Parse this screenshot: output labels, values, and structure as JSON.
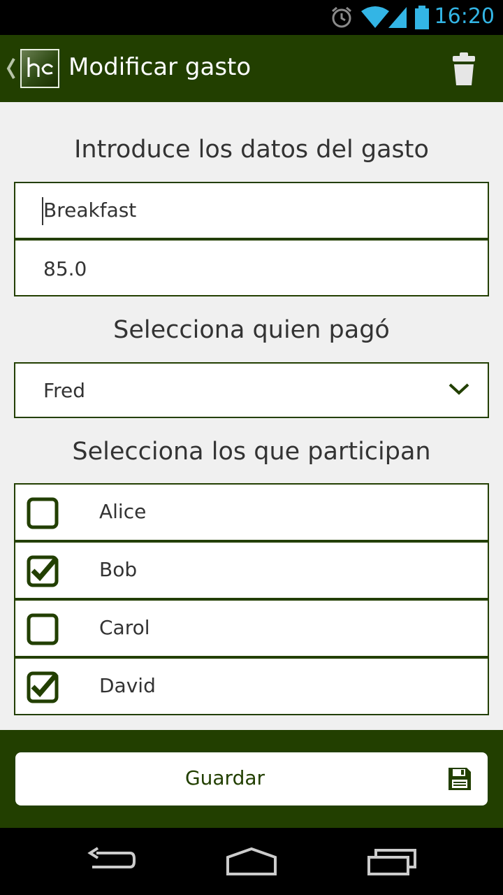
{
  "status_bar": {
    "time": "16:20",
    "icons": [
      "alarm-icon",
      "wifi-icon",
      "signal-icon",
      "battery-icon"
    ],
    "accent_color": "#33b5e5"
  },
  "action_bar": {
    "title": "Modificar gasto",
    "logo_text": "hc",
    "background_color": "#223f00",
    "actions": [
      "trash-icon"
    ]
  },
  "form": {
    "heading_expense": "Introduce los datos del gasto",
    "name_value": "Breakfast",
    "amount_value": "85.0",
    "heading_payer": "Selecciona quien pagó",
    "payer_selected": "Fred",
    "heading_participants": "Selecciona los que participan",
    "participants": [
      {
        "name": "Alice",
        "checked": false
      },
      {
        "name": "Bob",
        "checked": true
      },
      {
        "name": "Carol",
        "checked": false
      },
      {
        "name": "David",
        "checked": true
      }
    ]
  },
  "bottom_bar": {
    "save_label": "Guardar",
    "save_icon": "floppy-disk-icon"
  },
  "nav_bar": {
    "buttons": [
      "back-icon",
      "home-icon",
      "recent-apps-icon"
    ]
  }
}
